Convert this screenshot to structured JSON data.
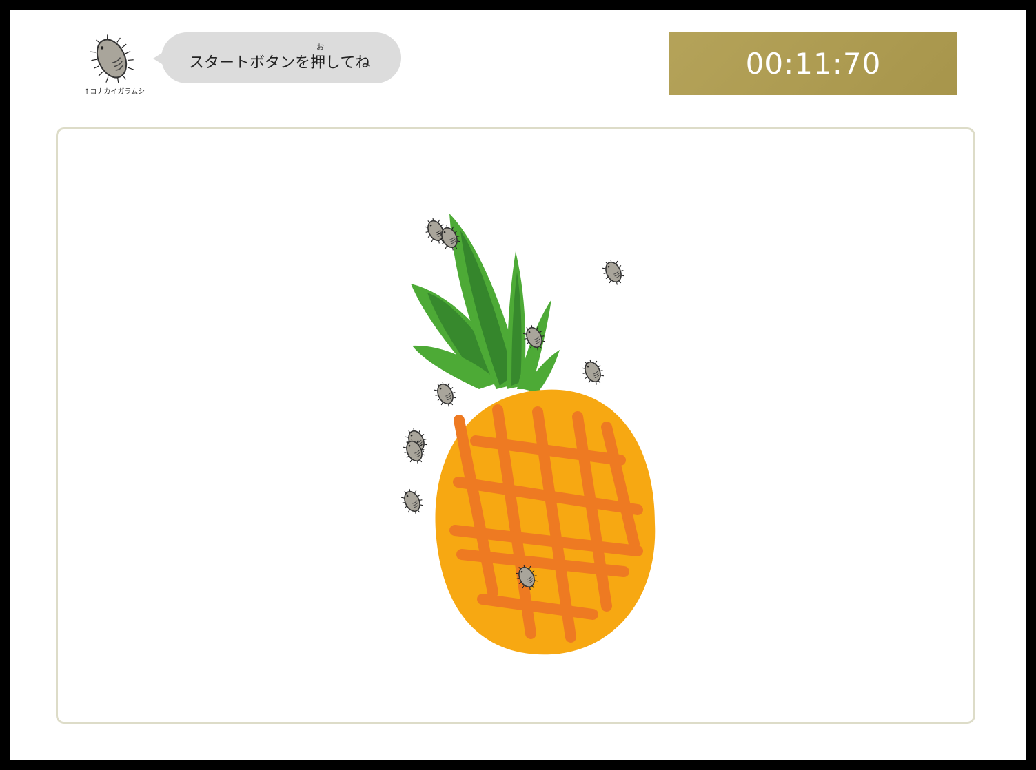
{
  "mascot": {
    "caption": "↑コナカイガラムシ",
    "icon": "mealybug-icon"
  },
  "speech_bubble": {
    "text": "スタートボタンを押してね",
    "ruby": "お"
  },
  "timer": {
    "value": "00:11:70"
  },
  "game": {
    "target_icon": "pineapple-icon",
    "bug_icon": "mealybug-icon",
    "bug_count": 11
  },
  "colors": {
    "timer_bg": "#b09d4f",
    "bubble_bg": "#dcdcdc",
    "board_border": "#dddcc8",
    "pineapple_body": "#f7a812",
    "pineapple_grid": "#ee7a22",
    "leaf_light": "#4daa36",
    "leaf_dark": "#2e7a2a",
    "bug_body": "#a9a59b"
  }
}
